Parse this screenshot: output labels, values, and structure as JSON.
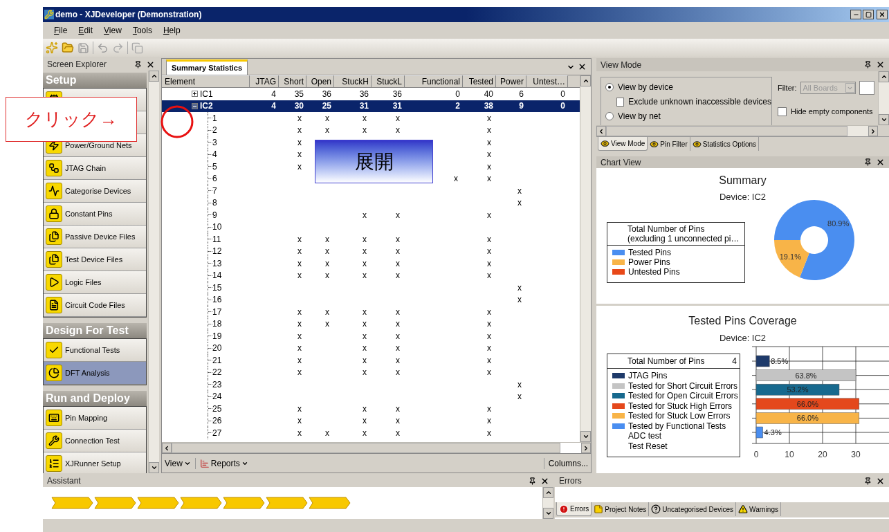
{
  "window": {
    "title": "demo - XJDeveloper (Demonstration)"
  },
  "menu": [
    {
      "label": "File"
    },
    {
      "label": "Edit"
    },
    {
      "label": "View"
    },
    {
      "label": "Tools"
    },
    {
      "label": "Help"
    }
  ],
  "screen_explorer": {
    "title": "Screen Explorer",
    "sections": [
      {
        "title": "Setup",
        "items": [
          {
            "selected": false
          },
          {
            "selected": false
          },
          {
            "label": "Power/Ground Nets",
            "selected": false
          },
          {
            "label": "JTAG Chain",
            "selected": false
          },
          {
            "label": "Categorise Devices",
            "selected": false
          },
          {
            "label": "Constant Pins",
            "selected": false
          },
          {
            "label": "Passive Device Files",
            "selected": false
          },
          {
            "label": "Test Device Files",
            "selected": false
          },
          {
            "label": "Logic Files",
            "selected": false
          },
          {
            "label": "Circuit Code Files",
            "selected": false
          }
        ]
      },
      {
        "title": "Design For Test",
        "items": [
          {
            "label": "Functional Tests",
            "selected": false
          },
          {
            "label": "DFT Analysis",
            "selected": true
          }
        ]
      },
      {
        "title": "Run and Deploy",
        "items": [
          {
            "label": "Pin Mapping",
            "selected": false
          },
          {
            "label": "Connection Test",
            "selected": false
          },
          {
            "label": "XJRunner Setup",
            "selected": false
          }
        ]
      }
    ]
  },
  "summary_statistics": {
    "tab": "Summary Statistics",
    "columns": [
      "Element",
      "JTAG",
      "Short",
      "Open",
      "StuckH",
      "StuckL",
      "Functional",
      "Tested",
      "Power",
      "Untest…"
    ],
    "rows": [
      {
        "expanded": false,
        "selected": false,
        "cells": [
          "IC1",
          "4",
          "35",
          "36",
          "36",
          "36",
          "0",
          "40",
          "6",
          "0"
        ]
      },
      {
        "expanded": true,
        "selected": true,
        "cells": [
          "IC2",
          "4",
          "30",
          "25",
          "31",
          "31",
          "2",
          "38",
          "9",
          "0"
        ],
        "children": [
          {
            "cells": [
              "1",
              null,
              "x",
              "x",
              "x",
              "x",
              null,
              "x",
              null,
              null
            ]
          },
          {
            "cells": [
              "2",
              null,
              "x",
              "x",
              "x",
              "x",
              null,
              "x",
              null,
              null
            ]
          },
          {
            "cells": [
              "3",
              null,
              "x",
              null,
              null,
              null,
              null,
              "x",
              null,
              null
            ]
          },
          {
            "cells": [
              "4",
              null,
              "x",
              null,
              null,
              null,
              null,
              "x",
              null,
              null
            ]
          },
          {
            "cells": [
              "5",
              null,
              "x",
              null,
              null,
              null,
              null,
              "x",
              null,
              null
            ]
          },
          {
            "cells": [
              "6",
              null,
              null,
              null,
              null,
              null,
              "x",
              "x",
              null,
              null
            ]
          },
          {
            "cells": [
              "7",
              null,
              null,
              null,
              null,
              null,
              null,
              null,
              "x",
              null
            ]
          },
          {
            "cells": [
              "8",
              null,
              null,
              null,
              null,
              null,
              null,
              null,
              "x",
              null
            ]
          },
          {
            "cells": [
              "9",
              null,
              null,
              null,
              "x",
              "x",
              null,
              "x",
              null,
              null
            ]
          },
          {
            "cells": [
              "10",
              null,
              null,
              null,
              null,
              null,
              null,
              null,
              null,
              null
            ]
          },
          {
            "cells": [
              "11",
              null,
              "x",
              "x",
              "x",
              "x",
              null,
              "x",
              null,
              null
            ]
          },
          {
            "cells": [
              "12",
              null,
              "x",
              "x",
              "x",
              "x",
              null,
              "x",
              null,
              null
            ]
          },
          {
            "cells": [
              "13",
              null,
              "x",
              "x",
              "x",
              "x",
              null,
              "x",
              null,
              null
            ]
          },
          {
            "cells": [
              "14",
              null,
              "x",
              "x",
              "x",
              "x",
              null,
              "x",
              null,
              null
            ]
          },
          {
            "cells": [
              "15",
              null,
              null,
              null,
              null,
              null,
              null,
              null,
              "x",
              null
            ]
          },
          {
            "cells": [
              "16",
              null,
              null,
              null,
              null,
              null,
              null,
              null,
              "x",
              null
            ]
          },
          {
            "cells": [
              "17",
              null,
              "x",
              "x",
              "x",
              "x",
              null,
              "x",
              null,
              null
            ]
          },
          {
            "cells": [
              "18",
              null,
              "x",
              "x",
              "x",
              "x",
              null,
              "x",
              null,
              null
            ]
          },
          {
            "cells": [
              "19",
              null,
              "x",
              null,
              "x",
              "x",
              null,
              "x",
              null,
              null
            ]
          },
          {
            "cells": [
              "20",
              null,
              "x",
              null,
              "x",
              "x",
              null,
              "x",
              null,
              null
            ]
          },
          {
            "cells": [
              "21",
              null,
              "x",
              null,
              "x",
              "x",
              null,
              "x",
              null,
              null
            ]
          },
          {
            "cells": [
              "22",
              null,
              "x",
              null,
              "x",
              "x",
              null,
              "x",
              null,
              null
            ]
          },
          {
            "cells": [
              "23",
              null,
              null,
              null,
              null,
              null,
              null,
              null,
              "x",
              null
            ]
          },
          {
            "cells": [
              "24",
              null,
              null,
              null,
              null,
              null,
              null,
              null,
              "x",
              null
            ]
          },
          {
            "cells": [
              "25",
              null,
              "x",
              null,
              "x",
              "x",
              null,
              "x",
              null,
              null
            ]
          },
          {
            "cells": [
              "26",
              null,
              "x",
              null,
              "x",
              "x",
              null,
              "x",
              null,
              null
            ]
          },
          {
            "cells": [
              "27",
              null,
              "x",
              "x",
              "x",
              "x",
              null,
              "x",
              null,
              null
            ]
          }
        ]
      }
    ],
    "footer": {
      "view": "View",
      "reports": "Reports",
      "columns": "Columns..."
    }
  },
  "view_mode": {
    "title": "View Mode",
    "radios": [
      {
        "label": "View by device",
        "selected": true
      },
      {
        "label": "View by net",
        "selected": false
      }
    ],
    "exclude": {
      "label": "Exclude unknown inaccessible devices",
      "checked": false
    },
    "filter": {
      "label": "Filter:",
      "value": "All Boards",
      "disabled": true
    },
    "hide_empty": {
      "label": "Hide empty components",
      "checked": false
    },
    "tabs": [
      {
        "label": "View Mode",
        "selected": true
      },
      {
        "label": "Pin Filter",
        "selected": false
      },
      {
        "label": "Statistics Options",
        "selected": false
      }
    ]
  },
  "chart_view": {
    "title": "Chart View",
    "summary": {
      "title": "Summary",
      "subtitle": "Device: IC2",
      "legend_title": [
        "Total Number of Pins",
        "(excluding 1 unconnected pi…"
      ],
      "chart_data": {
        "type": "donut",
        "categories": [
          "Tested Pins",
          "Power Pins",
          "Untested Pins"
        ],
        "values": [
          80.9,
          19.1,
          0
        ],
        "colors": [
          "#4a8ef0",
          "#f8b448",
          "#e84818"
        ],
        "value_labels": [
          "80.9%",
          "19.1%",
          null
        ]
      }
    },
    "coverage": {
      "title": "Tested Pins Coverage",
      "subtitle": "Device: IC2",
      "legend_title": "Total Number of Pins",
      "legend_count": "4",
      "extra_legend": [
        "ADC test",
        "Test Reset"
      ],
      "chart_data": {
        "type": "bar",
        "orientation": "horizontal",
        "grid": true,
        "xlim": [
          0,
          40
        ],
        "xticks": [
          0,
          10,
          20,
          30
        ],
        "series": [
          {
            "name": "JTAG Pins",
            "color": "#1e3a6a",
            "values": [
              4
            ]
          },
          {
            "name": "Tested for Short Circuit Errors",
            "color": "#c4c4c4",
            "values": [
              30
            ]
          },
          {
            "name": "Tested for Open Circuit Errors",
            "color": "#17698e",
            "values": [
              25
            ]
          },
          {
            "name": "Tested for Stuck High Errors",
            "color": "#e4481c",
            "values": [
              31
            ]
          },
          {
            "name": "Tested for Stuck Low Errors",
            "color": "#f8b448",
            "values": [
              31
            ]
          },
          {
            "name": "Tested by Functional Tests",
            "color": "#4a8ef0",
            "values": [
              2
            ]
          }
        ],
        "value_labels": [
          "8.5%",
          "63.8%",
          "53.2%",
          "66.0%",
          "66.0%",
          "4.3%"
        ]
      }
    }
  },
  "assistant": {
    "title": "Assistant"
  },
  "errors": {
    "title": "Errors",
    "tabs": [
      {
        "label": "Errors",
        "selected": true
      },
      {
        "label": "Project Notes",
        "selected": false
      },
      {
        "label": "Uncategorised Devices",
        "selected": false
      },
      {
        "label": "Warnings",
        "selected": false
      }
    ]
  },
  "annotations": {
    "click_callout": "クリック→",
    "expand_callout": "展開"
  }
}
